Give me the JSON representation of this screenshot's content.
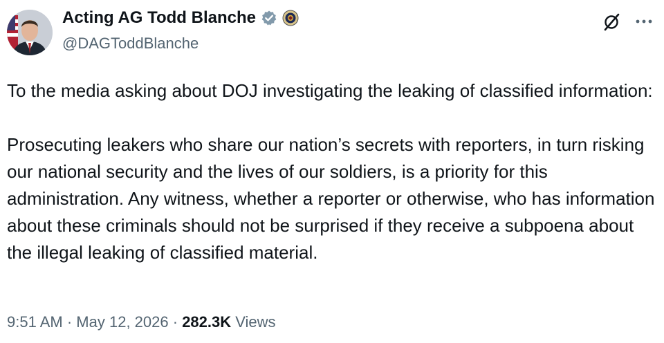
{
  "author": {
    "display_name": "Acting AG Todd Blanche",
    "handle": "@DAGToddBlanche",
    "avatar_icon": "profile-photo",
    "verified_icon": "verified-badge-icon",
    "affiliation_icon": "doj-seal-icon"
  },
  "post": {
    "paragraphs": [
      "To the media asking about DOJ investigating the leaking of classified information:",
      "Prosecuting leakers who share our nation’s secrets with reporters, in turn risking our national security and the lives of our soldiers, is a priority for this administration. Any witness, whether a reporter or otherwise, who has information about these criminals should not be surprised if they receive a subpoena about the illegal leaking of classified material."
    ]
  },
  "meta": {
    "time": "9:51 AM",
    "date": "May 12, 2026",
    "separator": "·",
    "views_count": "282.3K",
    "views_label": "Views"
  },
  "actions": {
    "grok_icon": "grok-icon",
    "more_icon": "more-options-icon"
  },
  "colors": {
    "text": "#0f1419",
    "secondary": "#536471",
    "verified_badge": "#829aab"
  }
}
